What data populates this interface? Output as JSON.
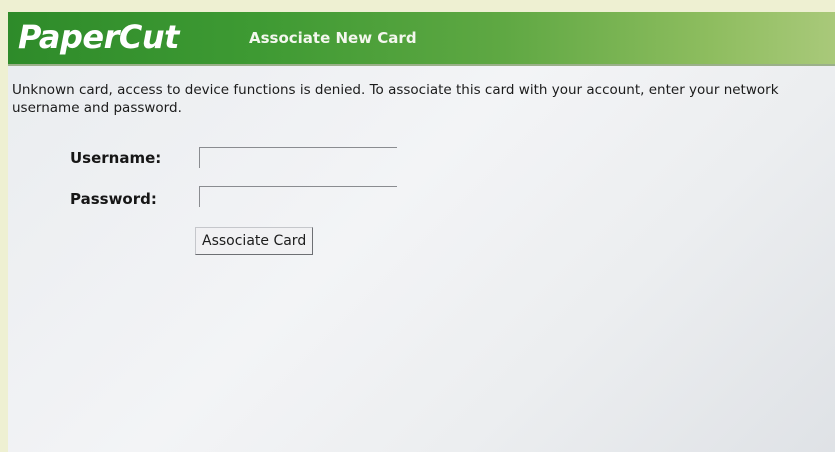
{
  "header": {
    "logo": "PaperCut",
    "title": "Associate New Card"
  },
  "message": "Unknown card, access to device functions is denied. To associate this card with your account, enter your network username and password.",
  "form": {
    "username_label": "Username:",
    "username_value": "",
    "password_label": "Password:",
    "password_value": "",
    "submit_label": "Associate Card"
  },
  "colors": {
    "header_green": "#3e9a33",
    "header_text": "#ffffff",
    "frame_yellow": "#eef0d2"
  }
}
